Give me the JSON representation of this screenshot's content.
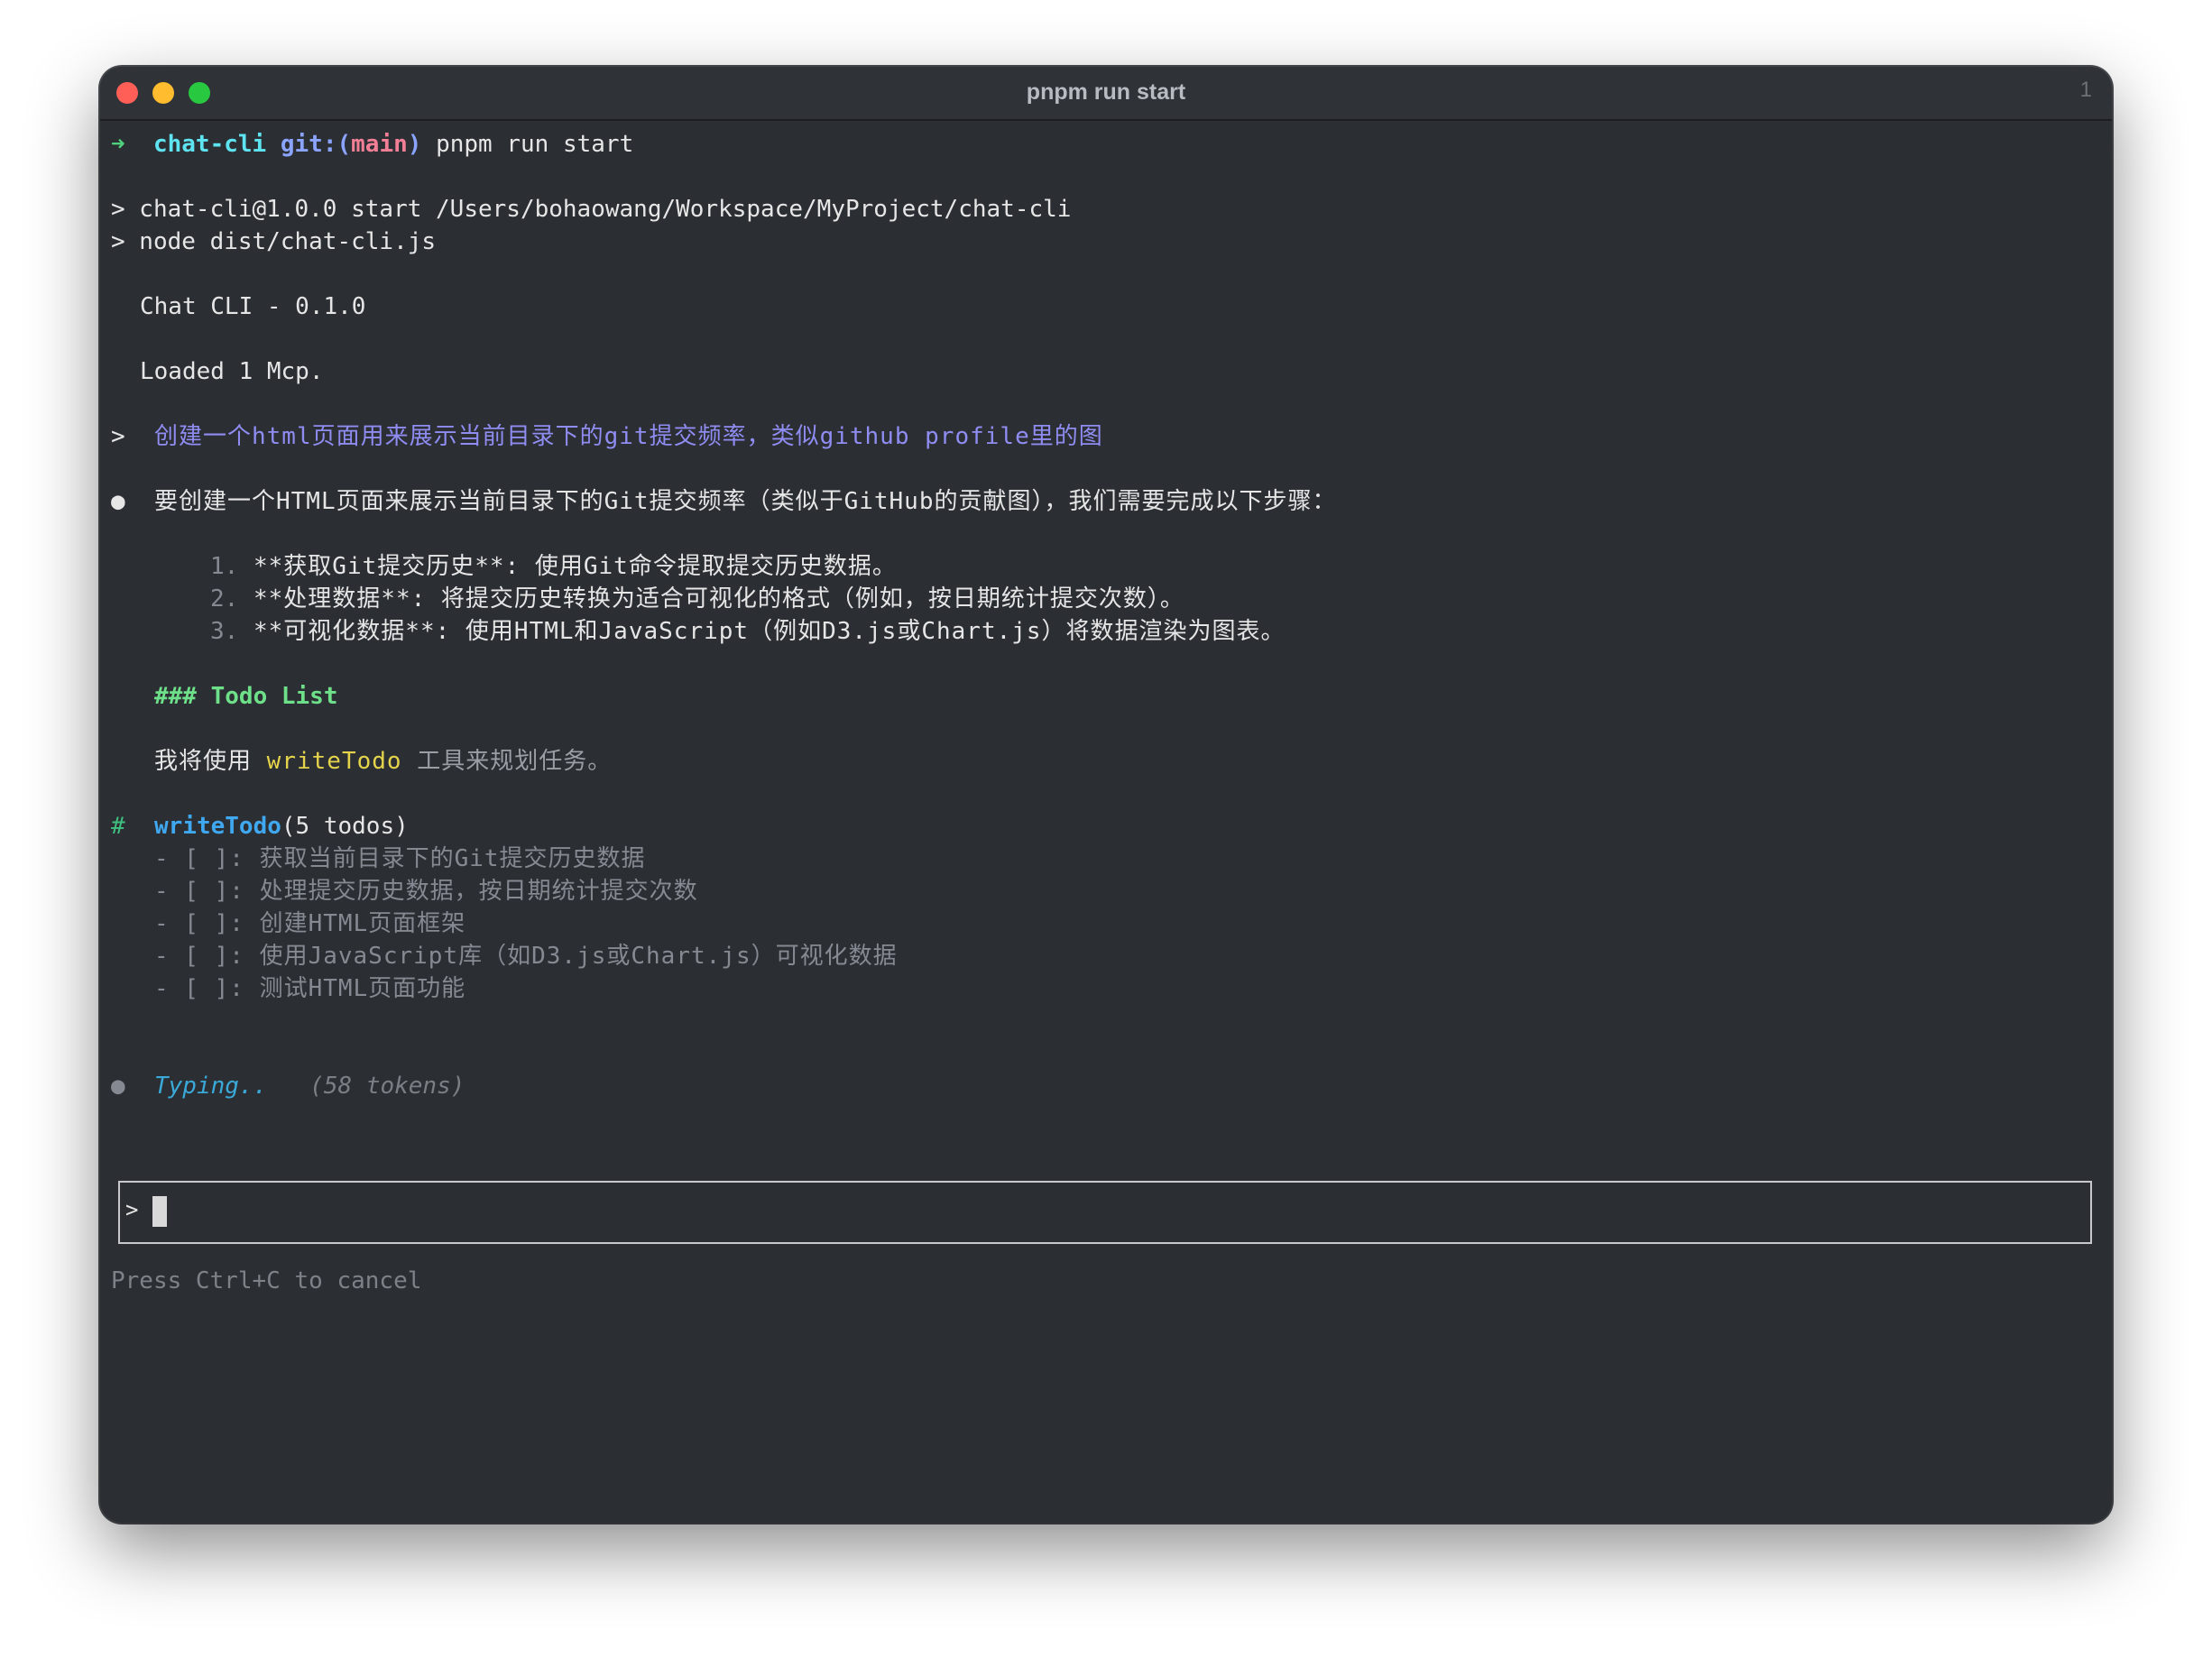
{
  "window": {
    "title": "pnpm run start",
    "tab_count": "1"
  },
  "prompt": {
    "arrow": "➜",
    "dir": "chat-cli",
    "git_label": "git:(",
    "branch": "main",
    "git_close": ")",
    "command": "pnpm run start"
  },
  "output": {
    "script_line1": "> chat-cli@1.0.0 start /Users/bohaowang/Workspace/MyProject/chat-cli",
    "script_line2": "> node dist/chat-cli.js",
    "banner": "Chat CLI - 0.1.0",
    "loaded": "Loaded 1 Mcp."
  },
  "user_message": {
    "marker": ">",
    "text": "创建一个html页面用来展示当前目录下的git提交频率，类似github profile里的图"
  },
  "assistant": {
    "bullet": "●",
    "intro": "要创建一个HTML页面来展示当前目录下的Git提交频率（类似于GitHub的贡献图），我们需要完成以下步骤：",
    "steps": [
      {
        "num": "1.",
        "text": "**获取Git提交历史**: 使用Git命令提取提交历史数据。"
      },
      {
        "num": "2.",
        "text": "**处理数据**: 将提交历史转换为适合可视化的格式（例如，按日期统计提交次数）。"
      },
      {
        "num": "3.",
        "text": "**可视化数据**: 使用HTML和JavaScript（例如D3.js或Chart.js）将数据渲染为图表。"
      }
    ],
    "heading": "### Todo List",
    "tool_sentence_pre": "我将使用",
    "tool_sentence_tool": "writeTodo",
    "tool_sentence_post": "工具来规划任务。"
  },
  "tool_call": {
    "marker": "#",
    "name": "writeTodo",
    "args": "(5 todos)",
    "todos": [
      "- [ ]: 获取当前目录下的Git提交历史数据",
      "- [ ]: 处理提交历史数据，按日期统计提交次数",
      "- [ ]: 创建HTML页面框架",
      "- [ ]: 使用JavaScript库（如D3.js或Chart.js）可视化数据",
      "- [ ]: 测试HTML页面功能"
    ]
  },
  "status": {
    "bullet": "●",
    "typing": "Typing..",
    "tokens": "(58 tokens)"
  },
  "input": {
    "prompt": ">",
    "value": ""
  },
  "hint": "Press Ctrl+C to cancel",
  "colors": {
    "background": "#2b2e33",
    "prompt_arrow": "#4fd27d",
    "dir": "#5ee4f0",
    "branch": "#f37f97",
    "user_message": "#8f8cf2",
    "heading": "#6ee089",
    "tool_name": "#3fa8f0",
    "highlight": "#e5d44b"
  }
}
